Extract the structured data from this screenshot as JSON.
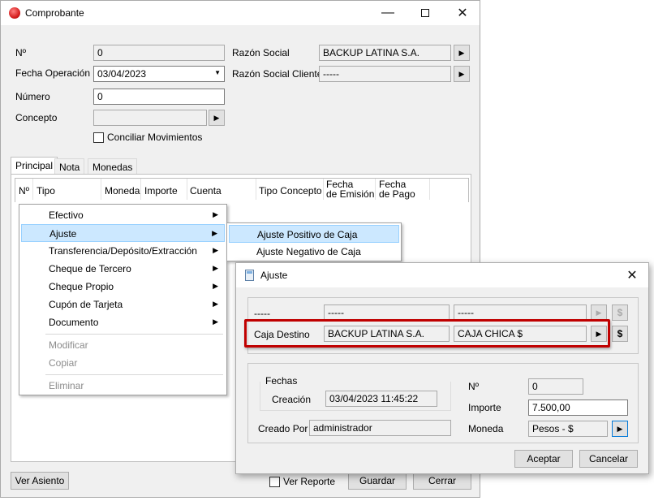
{
  "main": {
    "title": "Comprobante",
    "labels": {
      "nro": "Nº",
      "fecha": "Fecha Operación",
      "numero": "Número",
      "concepto": "Concepto",
      "razon": "Razón Social",
      "razon_cliente": "Razón Social Cliente"
    },
    "values": {
      "nro": "0",
      "fecha": "03/04/2023",
      "numero": "0",
      "concepto": "",
      "razon": "BACKUP LATINA S.A.",
      "razon_cliente": "-----"
    },
    "conciliar": "Conciliar Movimientos",
    "tabs": [
      "Principal",
      "Nota",
      "Monedas"
    ],
    "columns": [
      "Nº",
      "Tipo",
      "Moneda",
      "Importe",
      "Cuenta",
      "Tipo Concepto",
      "Fecha\nde Emisión",
      "Fecha\nde Pago"
    ],
    "buttons": {
      "ver_asiento": "Ver Asiento",
      "guardar": "Guardar",
      "cerrar": "Cerrar"
    },
    "ver_reporte": "Ver Reporte"
  },
  "context_menu": {
    "items": [
      "Efectivo",
      "Ajuste",
      "Transferencia/Depósito/Extracción",
      "Cheque de Tercero",
      "Cheque Propio",
      "Cupón de Tarjeta",
      "Documento",
      "Modificar",
      "Copiar",
      "Eliminar"
    ]
  },
  "submenu": {
    "items": [
      "Ajuste Positivo de Caja",
      "Ajuste Negativo de Caja"
    ]
  },
  "ajuste": {
    "title": "Ajuste",
    "row1": {
      "label": "-----",
      "field1": "-----",
      "field2": "-----"
    },
    "row2": {
      "label": "Caja Destino",
      "field1": "BACKUP LATINA S.A.",
      "field2": "CAJA CHICA $"
    },
    "dollar": "$",
    "fechas": "Fechas",
    "creacion_label": "Creación",
    "creacion": "03/04/2023 11:45:22",
    "creado_por_label": "Creado Por",
    "creado_por": "administrador",
    "nro_label": "Nº",
    "nro": "0",
    "importe_label": "Importe",
    "importe": "7.500,00",
    "moneda_label": "Moneda",
    "moneda": "Pesos - $",
    "aceptar": "Aceptar",
    "cancelar": "Cancelar"
  },
  "colors": {
    "highlight_border": "#c00000",
    "menu_highlight": "#cce8ff",
    "app_icon": "#d62020"
  }
}
